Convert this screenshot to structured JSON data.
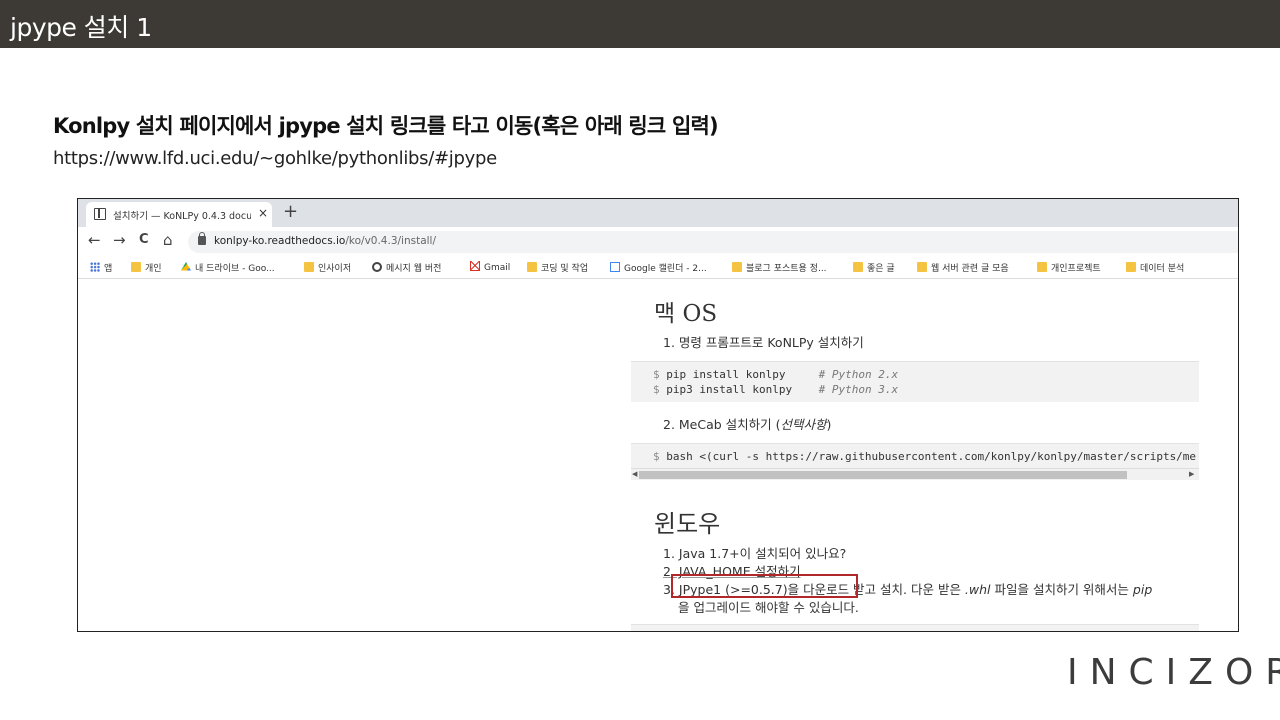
{
  "slide": {
    "title": "jpype 설치 1",
    "heading": "Konlpy 설치 페이지에서 jpype 설치 링크를 타고 이동(혹은 아래 링크 입력)",
    "url": "https://www.lfd.uci.edu/~gohlke/pythonlibs/#jpype",
    "logo": "INCIZOR"
  },
  "browser": {
    "tab_title": "설치하기 — KoNLPy 0.4.3 docu",
    "tab_close": "×",
    "new_tab": "+",
    "nav": {
      "back": "←",
      "forward": "→",
      "reload": "C",
      "home": "⌂"
    },
    "address": {
      "host": "konlpy-ko.readthedocs.io",
      "path": "/ko/v0.4.3/install/"
    },
    "bookmarks": [
      {
        "label": "앱",
        "icon": "apps-icon"
      },
      {
        "label": "개인",
        "icon": "folder-icon"
      },
      {
        "label": "내 드라이브 - Goo...",
        "icon": "drive-icon"
      },
      {
        "label": "인사이저",
        "icon": "folder-icon"
      },
      {
        "label": "메시지 웹 버전",
        "icon": "messages-icon"
      },
      {
        "label": "Gmail",
        "icon": "gmail-icon"
      },
      {
        "label": "코딩 및 작업",
        "icon": "folder-icon"
      },
      {
        "label": "Google 캘린더 - 2...",
        "icon": "calendar-icon"
      },
      {
        "label": "블로그 포스트용 정...",
        "icon": "folder-icon"
      },
      {
        "label": "좋은 글",
        "icon": "folder-icon"
      },
      {
        "label": "웹 서버 관련 글 모음",
        "icon": "folder-icon"
      },
      {
        "label": "개인프로젝트",
        "icon": "folder-icon"
      },
      {
        "label": "데이터 분석",
        "icon": "folder-icon"
      }
    ]
  },
  "docs": {
    "mac_heading": "맥 OS",
    "mac_step1": "1. 명령 프롬프트로 KoNLPy 설치하기",
    "code1_line1_cmd": "pip install konlpy",
    "code1_line1_cmt": "# Python 2.x",
    "code1_line2_cmd": "pip3 install konlpy",
    "code1_line2_cmt": "# Python 3.x",
    "prompt": "$",
    "mac_step2_pre": "2. MeCab 설치하기 (",
    "mac_step2_em": "선택사항",
    "mac_step2_post": ")",
    "code2_line": "bash <(curl -s https://raw.githubusercontent.com/konlpy/konlpy/master/scripts/me",
    "win_heading": "윈도우",
    "win_step1": "1. Java 1.7+이 설치되어 있나요?",
    "win_step2": "2. JAVA_HOME 설정하기",
    "win_step3_num": "3.",
    "win_step3_link": "JPype1 (>=0.5.7)을 다운로드",
    "win_step3_rest1": " 받고 설치. 다운 받은 ",
    "win_step3_em1": ".whl",
    "win_step3_rest2": " 파일을 설치하기 위해서는 ",
    "win_step3_em2": "pip",
    "win_step3_cont": "을 업그레이드 해야할 수 있습니다."
  }
}
